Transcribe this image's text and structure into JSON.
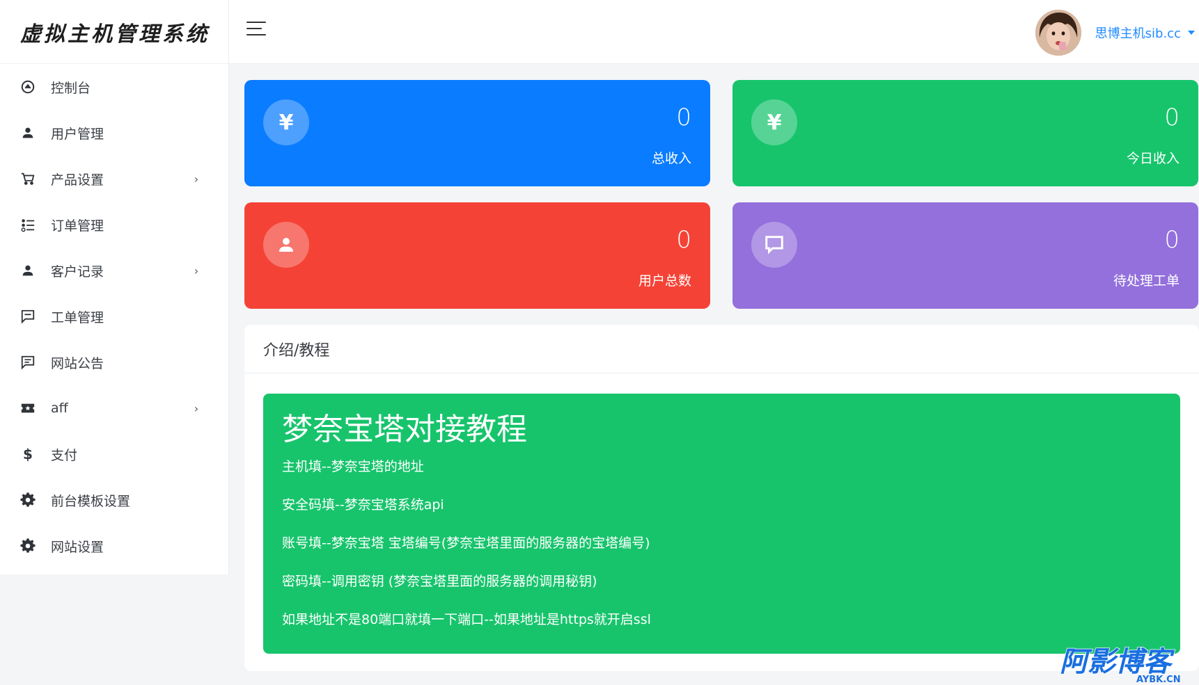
{
  "brand": {
    "title": "虚拟主机管理系统"
  },
  "sidebar": {
    "items": [
      {
        "label": "控制台",
        "icon": "dashboard-icon",
        "has_submenu": false
      },
      {
        "label": "用户管理",
        "icon": "user-icon",
        "has_submenu": false
      },
      {
        "label": "产品设置",
        "icon": "cart-icon",
        "has_submenu": true
      },
      {
        "label": "订单管理",
        "icon": "list-icon",
        "has_submenu": false
      },
      {
        "label": "客户记录",
        "icon": "user-icon",
        "has_submenu": true
      },
      {
        "label": "工单管理",
        "icon": "message-icon",
        "has_submenu": false
      },
      {
        "label": "网站公告",
        "icon": "message-text-icon",
        "has_submenu": false
      },
      {
        "label": "aff",
        "icon": "ticket-icon",
        "has_submenu": true
      },
      {
        "label": "支付",
        "icon": "dollar-icon",
        "has_submenu": false
      },
      {
        "label": "前台模板设置",
        "icon": "gear-icon",
        "has_submenu": false
      },
      {
        "label": "网站设置",
        "icon": "gear-icon",
        "has_submenu": false
      }
    ],
    "chevron": "›"
  },
  "topbar": {
    "menu_icon": "hamburger-icon",
    "user_name": "思博主机sib.cc"
  },
  "stats": [
    {
      "value": "0",
      "label": "总收入",
      "icon": "yen-icon",
      "glyph": "¥",
      "color": "#0a7cff"
    },
    {
      "value": "0",
      "label": "今日收入",
      "icon": "yen-icon",
      "glyph": "¥",
      "color": "#17c46c"
    },
    {
      "value": "0",
      "label": "用户总数",
      "icon": "user-icon",
      "color": "#f44336"
    },
    {
      "value": "0",
      "label": "待处理工单",
      "icon": "message-icon",
      "color": "#9370dc"
    }
  ],
  "intro": {
    "header": "介绍/教程",
    "title": "梦奈宝塔对接教程",
    "lines": [
      "主机填--梦奈宝塔的地址",
      "安全码填--梦奈宝塔系统api",
      "账号填--梦奈宝塔 宝塔编号(梦奈宝塔里面的服务器的宝塔编号)",
      "密码填--调用密钥 (梦奈宝塔里面的服务器的调用秘钥)",
      "如果地址不是80端口就填一下端口--如果地址是https就开启ssl"
    ]
  },
  "watermark": {
    "main": "阿影博客",
    "sub": "AYBK.CN"
  }
}
